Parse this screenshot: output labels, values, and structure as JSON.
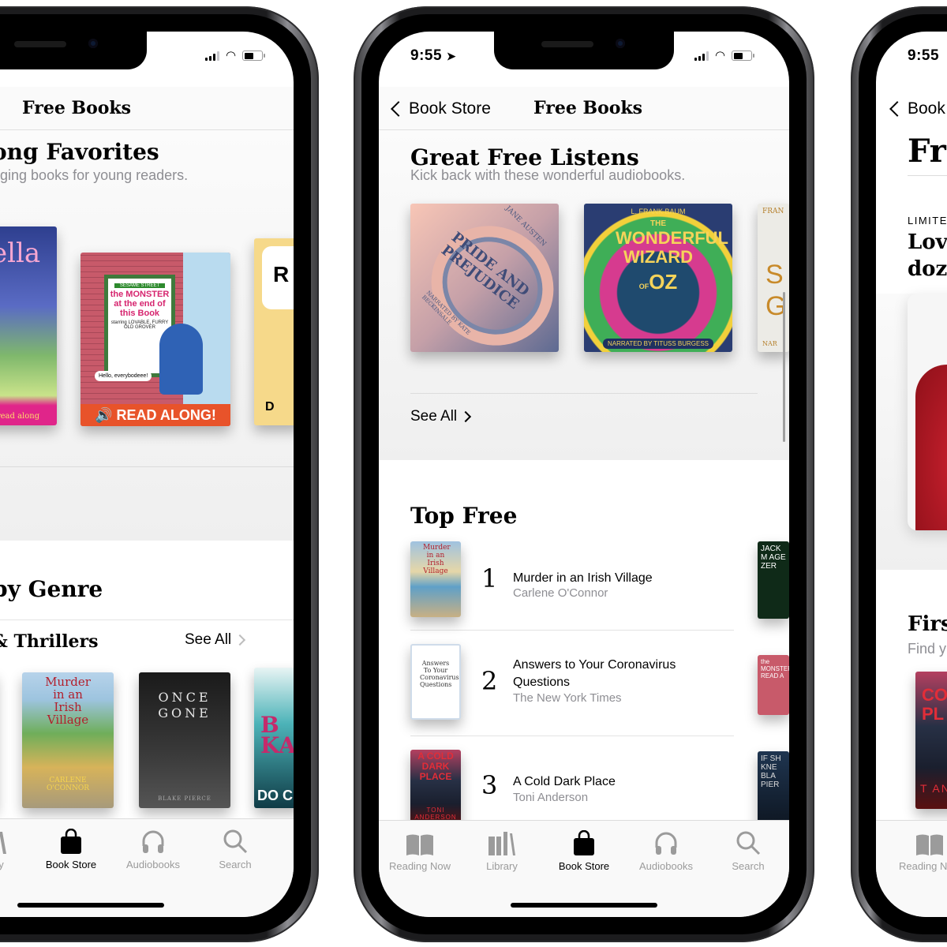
{
  "status_bar": {
    "time": "9:55"
  },
  "left_phone": {
    "nav_title": "Free Books",
    "section1": {
      "title": "Young Favorites",
      "title_visible": "ong Favorites",
      "subtitle_visible": "aging books for young readers."
    },
    "covers": [
      {
        "title_visible": "rella",
        "caption": "and read along"
      },
      {
        "series": "SESAME STREET",
        "title": "the MONSTER at the end of this Book",
        "tag": "starring LOVABLE, FURRY OLD GROVER",
        "bubble": "Hello, everybodeee!",
        "street_sign": "SESAME ST",
        "banner": "READ ALONG!"
      },
      {
        "title_visible": "R",
        "footer": "D"
      }
    ],
    "section2": {
      "title_visible": "by Genre",
      "subsection_visible": "& Thrillers",
      "see_all": "See All"
    },
    "genre_covers": [
      {
        "title": "Murder in an Irish Village",
        "author": "CARLENE O'CONNOR"
      },
      {
        "title": "ONCE GONE",
        "author": "BLAKE PIERCE"
      },
      {
        "title_visible": "B KA",
        "footer": "DO CL"
      }
    ],
    "tabs": [
      {
        "label_visible": "brary",
        "icon": "library-icon",
        "active": false
      },
      {
        "label": "Book Store",
        "icon": "shopping-bag-icon",
        "active": true
      },
      {
        "label": "Audiobooks",
        "icon": "headphones-icon",
        "active": false
      },
      {
        "label": "Search",
        "icon": "search-icon",
        "active": false
      }
    ]
  },
  "middle_phone": {
    "back_label": "Book Store",
    "nav_title": "Free Books",
    "listens": {
      "title": "Great Free Listens",
      "subtitle": "Kick back with these wonderful audiobooks.",
      "covers": [
        {
          "title": "PRIDE AND PREJUDICE",
          "author": "JANE AUSTEN",
          "narrator": "NARRATED BY KATE BECKINSALE"
        },
        {
          "author": "L. FRANK BAUM",
          "title_top": "THE",
          "title_main": "WONDERFUL WIZARD",
          "title_of": "OF",
          "title_oz": "OZ",
          "narrator": "NARRATED BY TITUSS BURGESS"
        },
        {
          "author_visible": "FRAN",
          "title_visible": "S G",
          "narrator_visible": "NAR"
        }
      ],
      "see_all": "See All"
    },
    "top_free": {
      "title": "Top Free",
      "items": [
        {
          "rank": "1",
          "title": "Murder in an Irish Village",
          "author": "Carlene O'Connor",
          "cover_text": "Murder in an Irish Village"
        },
        {
          "rank": "2",
          "title": "Answers to Your Coronavirus Questions",
          "author": "The New York Times",
          "cover_text": "Answers To Your Coronavirus Questions"
        },
        {
          "rank": "3",
          "title": "A Cold Dark Place",
          "author": "Toni Anderson",
          "cover_text": "A COLD DARK PLACE",
          "cover_author": "TONI ANDERSON"
        }
      ],
      "side_covers": [
        "JACK M AGE ZER",
        "the MONSTER READ A",
        "IF SH KNE BLA PIER"
      ]
    },
    "tabs": [
      {
        "label": "Reading Now",
        "icon": "reading-now-icon",
        "active": false
      },
      {
        "label": "Library",
        "icon": "library-icon",
        "active": false
      },
      {
        "label": "Book Store",
        "icon": "shopping-bag-icon",
        "active": true
      },
      {
        "label": "Audiobooks",
        "icon": "headphones-icon",
        "active": false
      },
      {
        "label": "Search",
        "icon": "search-icon",
        "active": false
      }
    ]
  },
  "right_phone": {
    "time": "9:55",
    "back_label_visible": "Book",
    "large_title_visible": "Fre",
    "eyebrow_visible": "LIMITE",
    "headline_visible_1": "Love",
    "headline_visible_2": "doze",
    "section_title_visible": "Firs",
    "section_sub_visible": "Find y",
    "cover_visible": {
      "title": "CO DA PL",
      "author": "T ANDE"
    },
    "tabs": [
      {
        "label_visible": "Reading Now",
        "icon": "reading-now-icon"
      }
    ]
  },
  "colors": {
    "text": "#000000",
    "secondary": "#8e8e93",
    "tab_inactive": "#9b9b9b",
    "separator": "#e0e0e0",
    "panel": "#f2f2f2"
  }
}
